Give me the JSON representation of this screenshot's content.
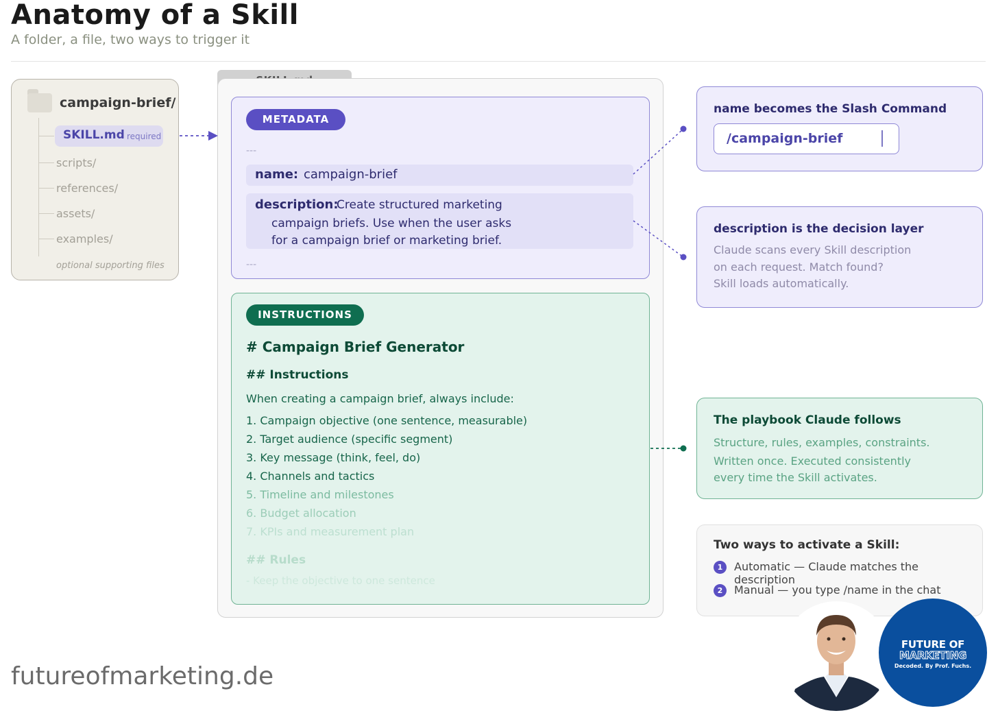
{
  "header": {
    "title": "Anatomy of a Skill",
    "subtitle": "A folder, a file, two ways to trigger it"
  },
  "folder": {
    "name": "campaign-brief/",
    "skill_file": "SKILL.md",
    "skill_required": "required",
    "items": [
      "scripts/",
      "references/",
      "assets/",
      "examples/"
    ],
    "note": "optional supporting files"
  },
  "file": {
    "tab_label": "SKILL.md",
    "metadata": {
      "pill": "METADATA",
      "dashes_open": "---",
      "name_key": "name:",
      "name_value": "campaign-brief",
      "description_key": "description:",
      "description_lines": [
        "Create structured marketing",
        "campaign briefs. Use when the user asks",
        "for a campaign brief or marketing brief."
      ],
      "dashes_close": "---"
    },
    "instructions": {
      "pill": "INSTRUCTIONS",
      "heading": "# Campaign Brief Generator",
      "subheading": "## Instructions",
      "lead": "When creating a campaign brief, always include:",
      "steps": [
        "1. Campaign objective (one sentence, measurable)",
        "2. Target audience (specific segment)",
        "3. Key message (think, feel, do)",
        "4. Channels and tactics",
        "5. Timeline and milestones",
        "6. Budget allocation",
        "7. KPIs and measurement plan"
      ],
      "rules_heading": "## Rules",
      "rules_first": "- Keep the objective to one sentence"
    }
  },
  "callouts": {
    "slash": {
      "title": "name becomes the Slash Command",
      "command": "/campaign-brief"
    },
    "description": {
      "title": "description is the decision layer",
      "lines": [
        "Claude scans every Skill description",
        "on each request. Match found?",
        "Skill loads automatically."
      ]
    },
    "playbook": {
      "title": "The playbook Claude follows",
      "lines": [
        "Structure, rules, examples, constraints.",
        "Written once. Executed consistently",
        "every time the Skill activates."
      ]
    },
    "ways": {
      "title": "Two ways to activate a Skill:",
      "items": [
        {
          "num": "1",
          "text": "Automatic — Claude matches the description"
        },
        {
          "num": "2",
          "text": "Manual — you type /name in the chat"
        }
      ]
    }
  },
  "footer": {
    "site": "futureofmarketing.de",
    "logo_line1": "FUTURE OF",
    "logo_line2": "MARKETING",
    "logo_line3": "Decoded. By Prof. Fuchs."
  },
  "colors": {
    "purple_accent": "#5a4fc3",
    "green_accent": "#0f6e50",
    "logo_blue": "#0a4f9e"
  }
}
